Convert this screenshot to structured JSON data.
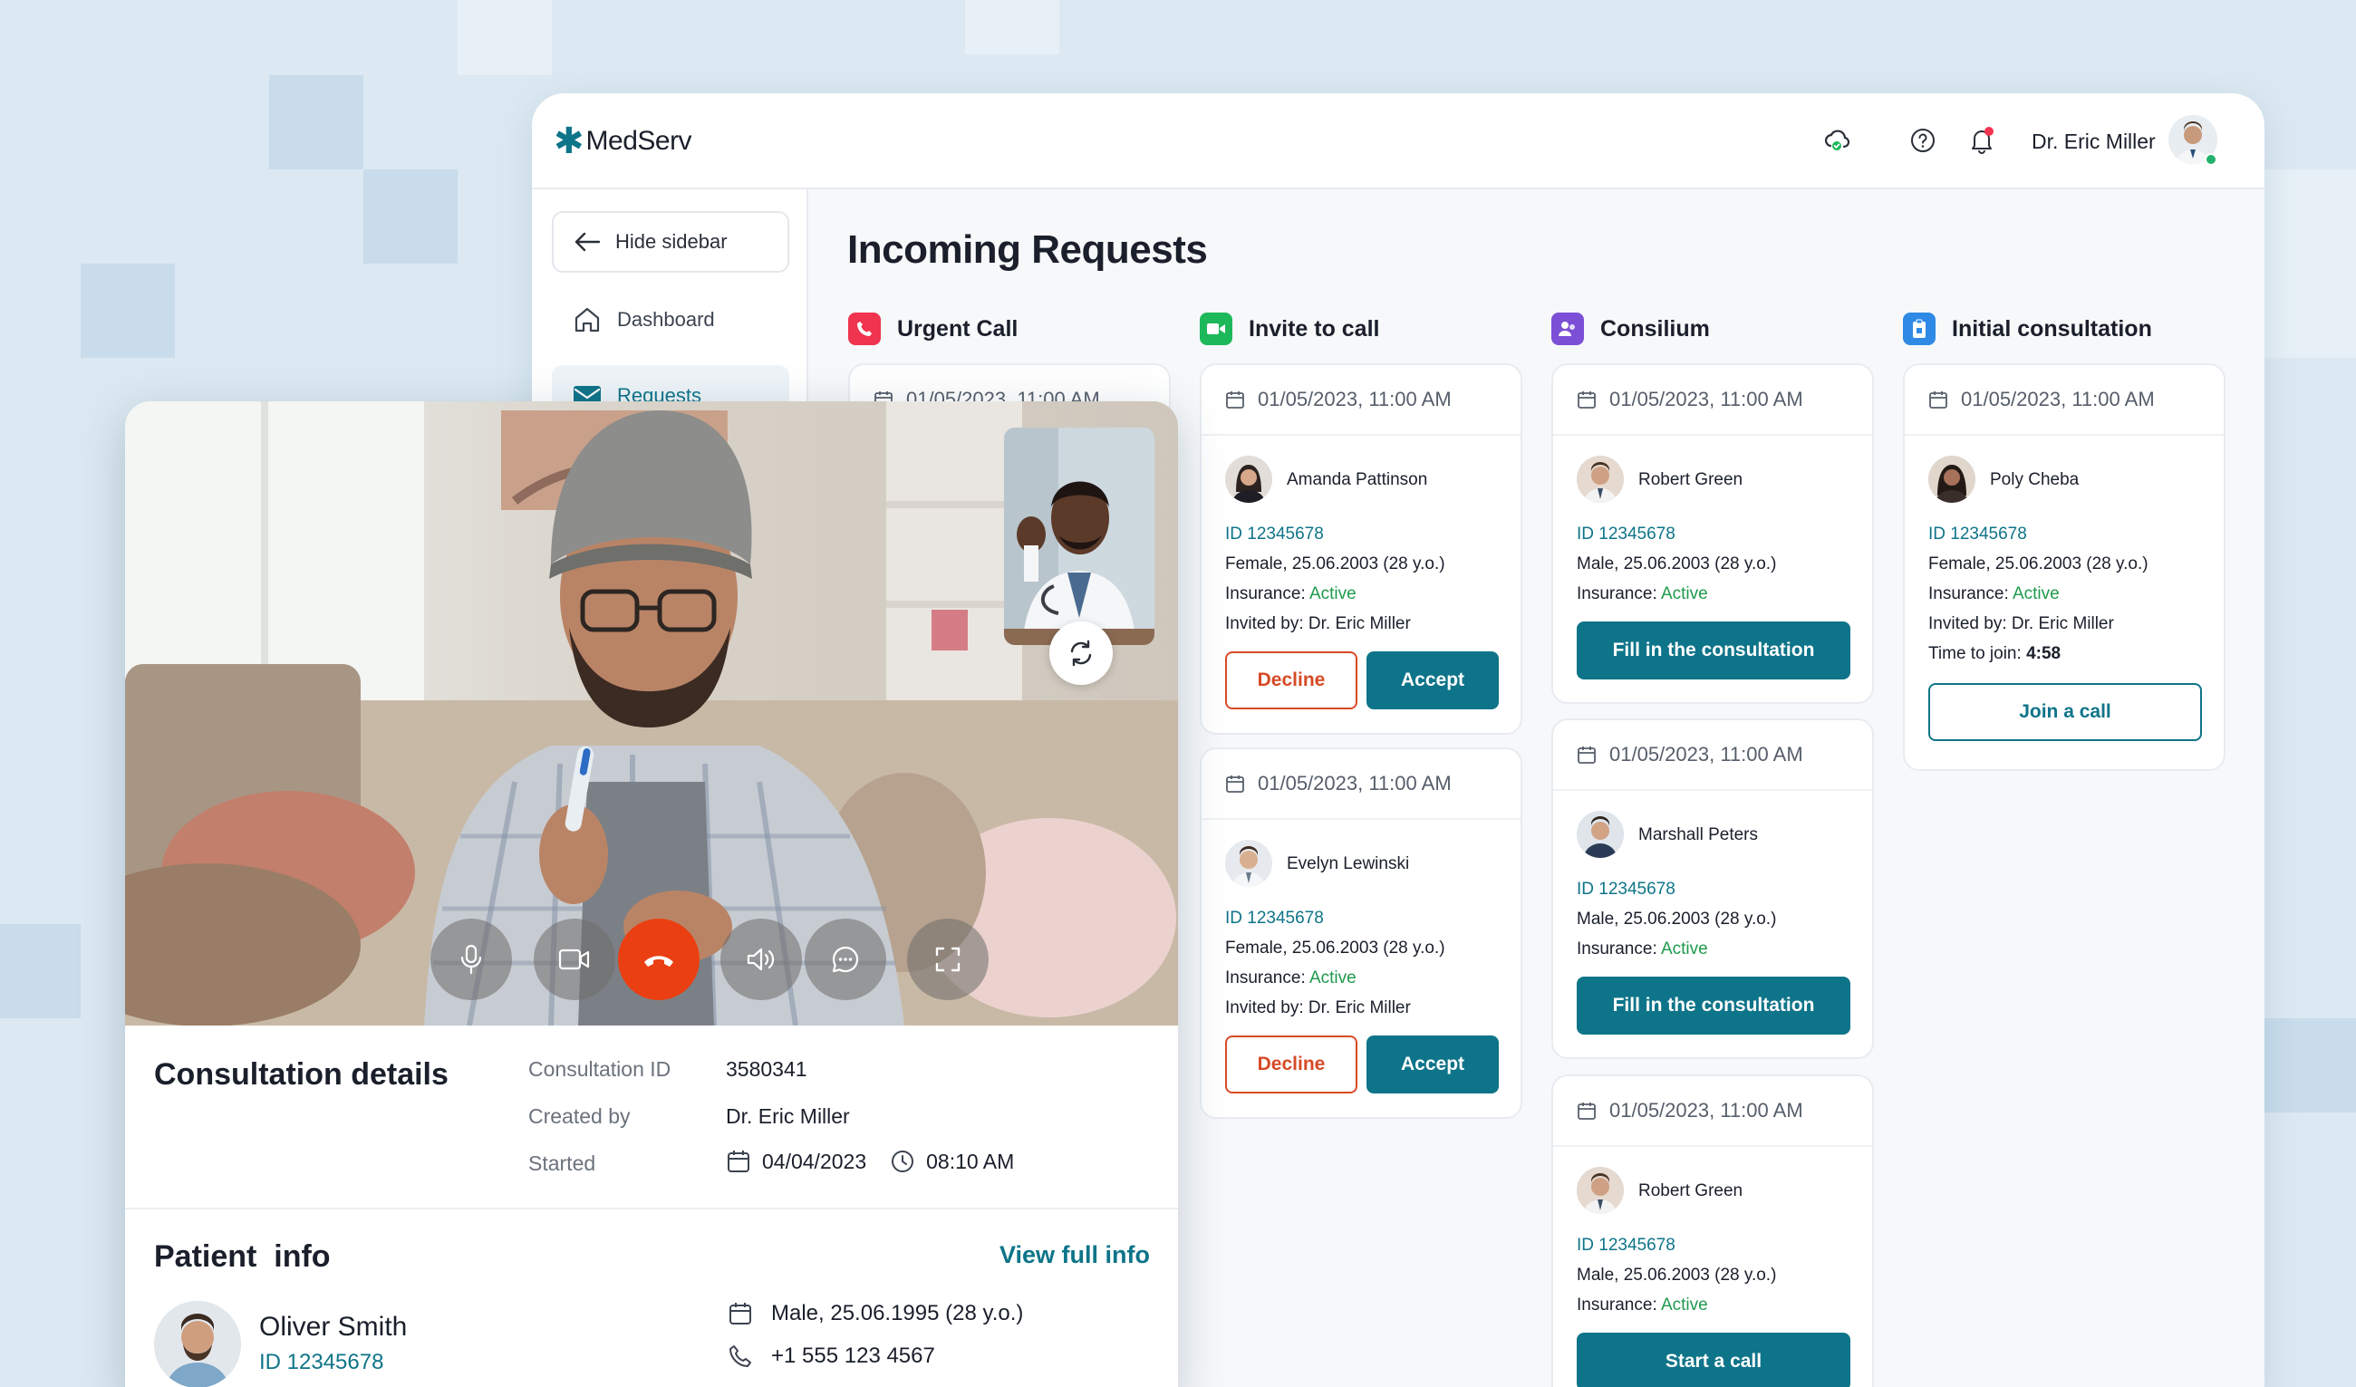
{
  "app": {
    "logo_text": "MedServ",
    "user_name": "Dr. Eric Miller",
    "accent": "#0e7489"
  },
  "sidebar": {
    "hide_label": "Hide sidebar",
    "items": [
      {
        "label": "Dashboard",
        "icon": "home-icon"
      },
      {
        "label": "Requests",
        "icon": "mail-icon",
        "active": true
      }
    ]
  },
  "main": {
    "title": "Incoming Requests",
    "columns": [
      {
        "title": "Urgent Call",
        "color": "#f0334e",
        "icon": "phone-icon",
        "cards": [
          {
            "date": "01/05/2023, 11:00 AM"
          }
        ]
      },
      {
        "title": "Invite to call",
        "color": "#1db85a",
        "icon": "video-icon",
        "cards": [
          {
            "date": "01/05/2023, 11:00 AM",
            "name": "Amanda Pattinson",
            "id": "ID 12345678",
            "details": "Female, 25.06.2003 (28 y.o.)",
            "insurance_label": "Insurance:",
            "insurance": "Active",
            "invited": "Invited by: Dr. Eric Miller",
            "decline": "Decline",
            "accept": "Accept"
          },
          {
            "date": "01/05/2023, 11:00 AM",
            "name": "Evelyn Lewinski",
            "id": "ID 12345678",
            "details": "Female, 25.06.2003 (28 y.o.)",
            "insurance_label": "Insurance:",
            "insurance": "Active",
            "invited": "Invited by: Dr. Eric Miller",
            "decline": "Decline",
            "accept": "Accept"
          }
        ]
      },
      {
        "title": "Consilium",
        "color": "#7b4fd6",
        "icon": "people-icon",
        "cards": [
          {
            "date": "01/05/2023, 11:00 AM",
            "name": "Robert Green",
            "id": "ID 12345678",
            "details": "Male, 25.06.2003 (28 y.o.)",
            "insurance_label": "Insurance:",
            "insurance": "Active",
            "action": "Fill in the consultation"
          },
          {
            "date": "01/05/2023, 11:00 AM",
            "name": "Marshall Peters",
            "id": "ID 12345678",
            "details": "Male, 25.06.2003 (28 y.o.)",
            "insurance_label": "Insurance:",
            "insurance": "Active",
            "action": "Fill in the consultation"
          },
          {
            "date": "01/05/2023, 11:00 AM",
            "name": "Robert Green",
            "id": "ID 12345678",
            "details": "Male, 25.06.2003 (28 y.o.)",
            "insurance_label": "Insurance:",
            "insurance": "Active",
            "action": "Start a call"
          }
        ]
      },
      {
        "title": "Initial consultation",
        "color": "#2f8ae6",
        "icon": "clipboard-icon",
        "cards": [
          {
            "date": "01/05/2023, 11:00 AM",
            "name": "Poly Cheba",
            "id": "ID 12345678",
            "details": "Female, 25.06.2003 (28 y.o.)",
            "insurance_label": "Insurance:",
            "insurance": "Active",
            "invited": "Invited by: Dr. Eric Miller",
            "time_label": "Time to join:",
            "time": "4:58",
            "action": "Join a call"
          }
        ]
      }
    ]
  },
  "call": {
    "controls": [
      "microphone-icon",
      "camera-icon",
      "end-call-icon",
      "speaker-icon",
      "chat-icon",
      "fullscreen-icon"
    ],
    "end_call_color": "#ea3f12"
  },
  "consultation": {
    "title": "Consultation details",
    "id_label": "Consultation ID",
    "id_value": "3580341",
    "created_label": "Created by",
    "created_value": "Dr. Eric Miller",
    "started_label": "Started",
    "started_date": "04/04/2023",
    "started_time": "08:10 AM"
  },
  "patient": {
    "title": "Patient  info",
    "view_link": "View full info",
    "name": "Oliver Smith",
    "id": "ID 12345678",
    "details": "Male, 25.06.1995 (28 y.o.)",
    "phone": "+1 555 123 4567"
  }
}
